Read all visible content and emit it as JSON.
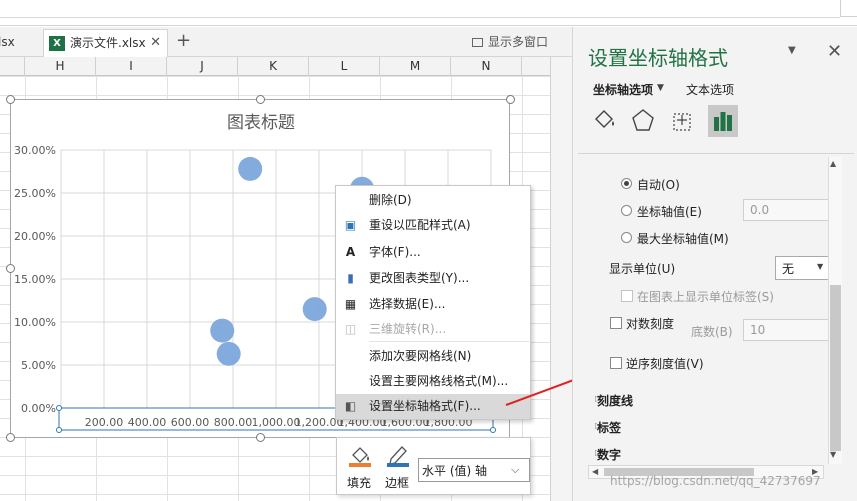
{
  "tabs": {
    "file1_partial": "lsx",
    "file2": "演示文件.xlsx",
    "show_multi_window": "显示多窗口"
  },
  "columns": [
    "H",
    "I",
    "J",
    "K",
    "L",
    "M",
    "N"
  ],
  "chart": {
    "title": "图表标题",
    "chart_data": {
      "type": "scatter",
      "title": "图表标题",
      "xlabel": "",
      "ylabel": "",
      "x_ticks": [
        "200.00",
        "400.00",
        "600.00",
        "800.00",
        "1,000.00",
        "1,200.00",
        "1,400.00",
        "1,600.00",
        "1,800.00"
      ],
      "y_ticks": [
        "0.00%",
        "5.00%",
        "10.00%",
        "15.00%",
        "20.00%",
        "25.00%",
        "30.00%"
      ],
      "xlim": [
        0,
        2000
      ],
      "ylim": [
        0,
        0.3
      ],
      "points": [
        {
          "x": 880,
          "y": 0.278
        },
        {
          "x": 1400,
          "y": 0.255
        },
        {
          "x": 750,
          "y": 0.09
        },
        {
          "x": 780,
          "y": 0.063
        },
        {
          "x": 1180,
          "y": 0.115
        }
      ],
      "marker_color": "#7ca7dc",
      "grid": true
    }
  },
  "context_menu": {
    "items": [
      {
        "label": "删除(D)",
        "icon": "",
        "disabled": false
      },
      {
        "label": "重设以匹配样式(A)",
        "icon": "reset-style-icon",
        "disabled": false
      },
      {
        "label": "字体(F)...",
        "icon": "font-icon",
        "disabled": false
      },
      {
        "label": "更改图表类型(Y)...",
        "icon": "chart-type-icon",
        "disabled": false
      },
      {
        "label": "选择数据(E)...",
        "icon": "select-data-icon",
        "disabled": false
      },
      {
        "label": "三维旋转(R)...",
        "icon": "rotate-3d-icon",
        "disabled": true
      },
      {
        "label": "添加次要网格线(N)",
        "icon": "",
        "disabled": false
      },
      {
        "label": "设置主要网格线格式(M)...",
        "icon": "",
        "disabled": false
      },
      {
        "label": "设置坐标轴格式(F)...",
        "icon": "format-axis-icon",
        "disabled": false,
        "highlighted": true
      }
    ]
  },
  "mini_toolbar": {
    "fill_label": "填充",
    "border_label": "边框",
    "element_select": "水平 (值) 轴"
  },
  "panel": {
    "title": "设置坐标轴格式",
    "tab_axis_options": "坐标轴选项",
    "tab_text_options": "文本选项",
    "radio_auto": "自动(O)",
    "radio_axis_value": "坐标轴值(E)",
    "axis_value_input": "0.0",
    "radio_max_axis_value": "最大坐标轴值(M)",
    "display_units_label": "显示单位(U)",
    "display_units_value": "无",
    "show_units_label": "在图表上显示单位标签(S)",
    "log_scale": "对数刻度",
    "base_label": "底数(B)",
    "base_value": "10",
    "reverse_order": "逆序刻度值(V)",
    "section_tick_marks": "刻度线",
    "section_labels": "标签",
    "section_number": "数字"
  },
  "watermark": "https://blog.csdn.net/qq_42737697",
  "colors": {
    "brand": "#217346",
    "accent": "#2e75b6",
    "marker": "#7ca7dc"
  }
}
